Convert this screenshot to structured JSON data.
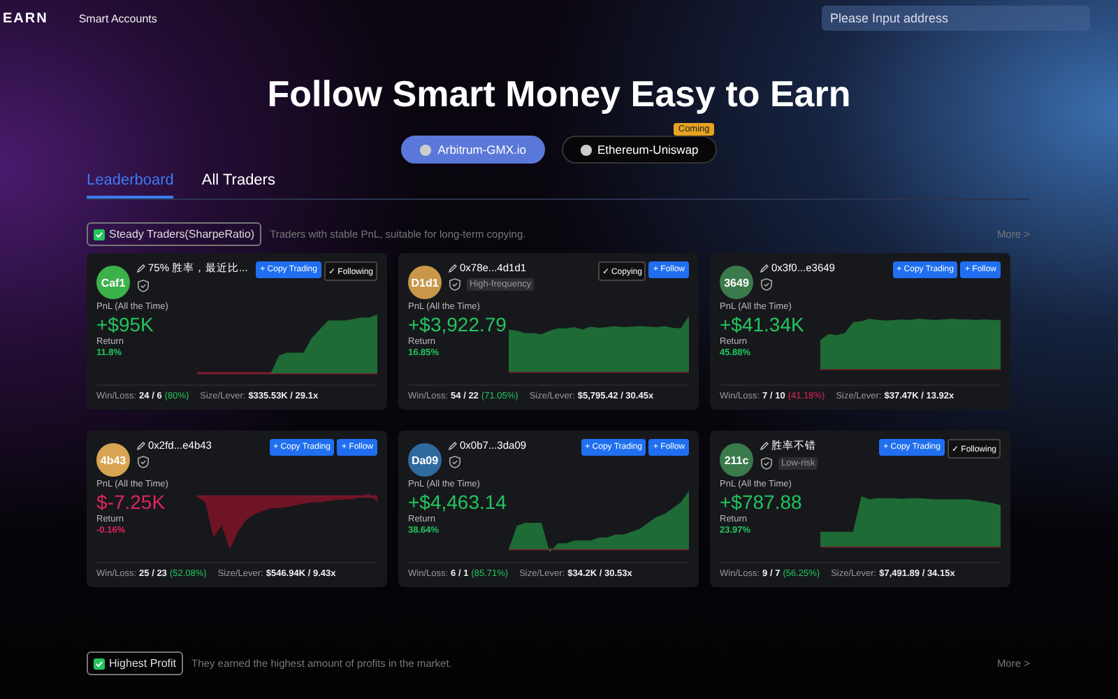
{
  "nav": {
    "logo": "EARN",
    "link": "Smart Accounts",
    "search": {
      "placeholder": "Please Input address"
    }
  },
  "hero": {
    "title": "Follow Smart Money Easy to Earn"
  },
  "chains": [
    {
      "label": "Arbitrum-GMX.io",
      "selected": true
    },
    {
      "label": "Ethereum-Uniswap",
      "selected": false,
      "badge": "Coming"
    }
  ],
  "tabs": [
    {
      "label": "Leaderboard",
      "selected": true
    },
    {
      "label": "All Traders",
      "selected": false
    }
  ],
  "sections": [
    {
      "title": "Steady Traders(SharpeRatio)",
      "subtitle": "Traders with stable PnL, suitable for long-term copying.",
      "more": "More >",
      "cards": [
        {
          "avatar": "Caf1",
          "color": "#3bb24a",
          "name": "75% 胜率，最近比...",
          "buttons": [
            {
              "label": "+ Copy Trading",
              "active": false
            },
            {
              "label": "✓ Following",
              "active": true
            }
          ],
          "pnl_label": "PnL (All the Time)",
          "pnl": "+$95K",
          "kind": "gain",
          "return_label": "Return",
          "return": "11.8%",
          "winloss_label": "Win/Loss:",
          "winloss": "24 / 6",
          "rate": {
            "text": "(80%)",
            "kind": "gain"
          },
          "size_label": "Size/Lever:",
          "size": "$335.53K / 29.1x"
        },
        {
          "avatar": "D1d1",
          "color": "#c9974a",
          "name": "0x78e...4d1d1",
          "tag": "High-frequency",
          "buttons": [
            {
              "label": "✓ Copying",
              "active": true
            },
            {
              "label": "+ Follow",
              "active": false
            }
          ],
          "pnl_label": "PnL (All the Time)",
          "pnl": "+$3,922.79",
          "kind": "gain",
          "return_label": "Return",
          "return": "16.85%",
          "winloss_label": "Win/Loss:",
          "winloss": "54 / 22",
          "rate": {
            "text": "(71.05%)",
            "kind": "gain"
          },
          "size_label": "Size/Lever:",
          "size": "$5,795.42 / 30.45x"
        },
        {
          "avatar": "3649",
          "color": "#3a7a4c",
          "name": "0x3f0...e3649",
          "buttons": [
            {
              "label": "+ Copy Trading",
              "active": false
            },
            {
              "label": "+ Follow",
              "active": false
            }
          ],
          "pnl_label": "PnL (All the Time)",
          "pnl": "+$41.34K",
          "kind": "gain",
          "return_label": "Return",
          "return": "45.88%",
          "winloss_label": "Win/Loss:",
          "winloss": "7 / 10",
          "rate": {
            "text": "(41.18%)",
            "kind": "loss"
          },
          "size_label": "Size/Lever:",
          "size": "$37.47K / 13.92x"
        },
        {
          "avatar": "4b43",
          "color": "#d9a451",
          "name": "0x2fd...e4b43",
          "buttons": [
            {
              "label": "+ Copy Trading",
              "active": false
            },
            {
              "label": "+ Follow",
              "active": false
            }
          ],
          "pnl_label": "PnL (All the Time)",
          "pnl": "$-7.25K",
          "kind": "loss",
          "return_label": "Return",
          "return": "-0.16%",
          "winloss_label": "Win/Loss:",
          "winloss": "25 / 23",
          "rate": {
            "text": "(52.08%)",
            "kind": "gain"
          },
          "size_label": "Size/Lever:",
          "size": "$546.94K / 9.43x"
        },
        {
          "avatar": "Da09",
          "color": "#2f6a9e",
          "name": "0x0b7...3da09",
          "buttons": [
            {
              "label": "+ Copy Trading",
              "active": false
            },
            {
              "label": "+ Follow",
              "active": false
            }
          ],
          "pnl_label": "PnL (All the Time)",
          "pnl": "+$4,463.14",
          "kind": "gain",
          "return_label": "Return",
          "return": "38.64%",
          "winloss_label": "Win/Loss:",
          "winloss": "6 / 1",
          "rate": {
            "text": "(85.71%)",
            "kind": "gain"
          },
          "size_label": "Size/Lever:",
          "size": "$34.2K / 30.53x"
        },
        {
          "avatar": "211c",
          "color": "#3a7a4c",
          "name": "胜率不错",
          "tag": "Low-risk",
          "buttons": [
            {
              "label": "+ Copy Trading",
              "active": false
            },
            {
              "label": "✓ Following",
              "active": true
            }
          ],
          "pnl_label": "PnL (All the Time)",
          "pnl": "+$787.88",
          "kind": "gain",
          "return_label": "Return",
          "return": "23.97%",
          "winloss_label": "Win/Loss:",
          "winloss": "9 / 7",
          "rate": {
            "text": "(56.25%)",
            "kind": "gain"
          },
          "size_label": "Size/Lever:",
          "size": "$7,491.89 / 34.15x"
        }
      ]
    },
    {
      "title": "Highest Profit",
      "subtitle": "They earned the highest amount of profits in the market.",
      "more": "More >"
    }
  ]
}
